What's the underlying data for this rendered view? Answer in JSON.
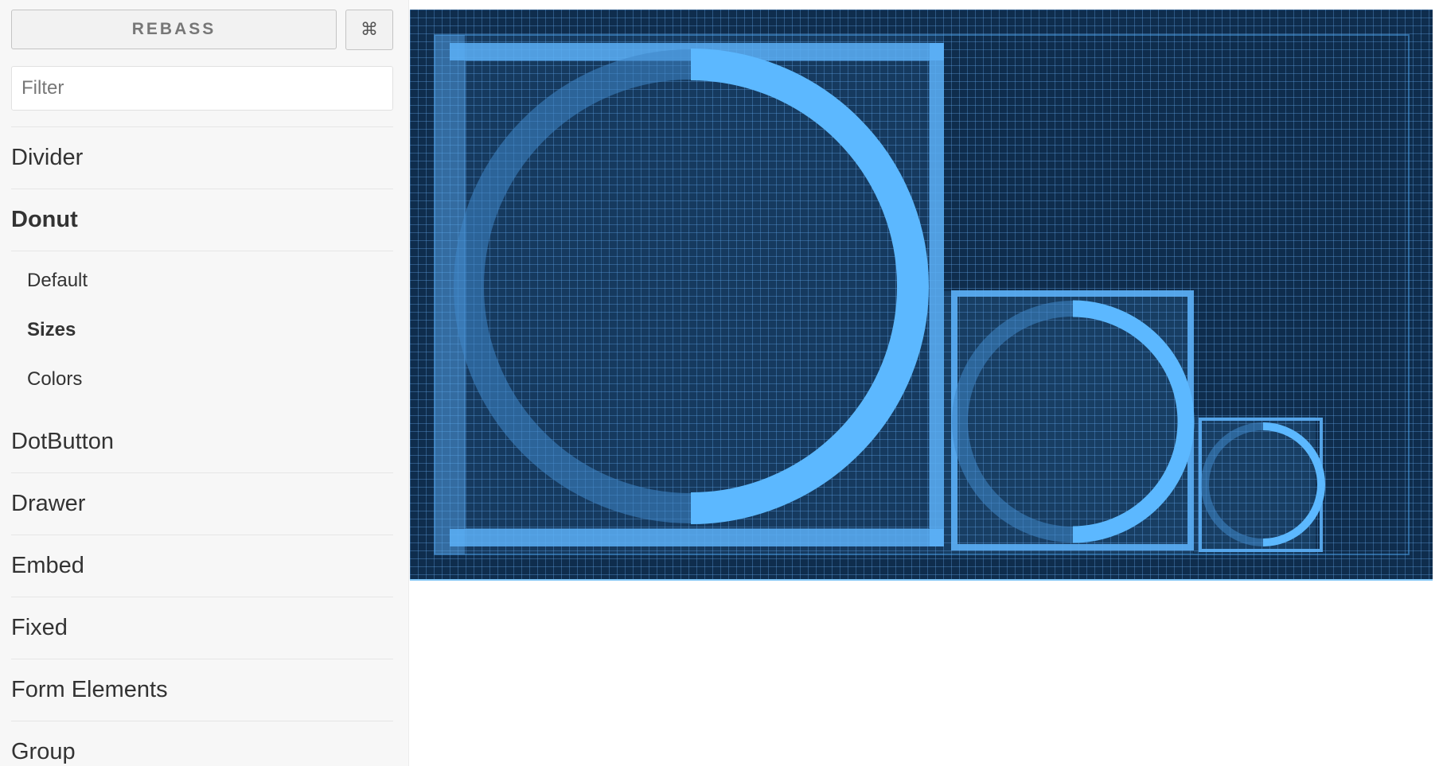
{
  "toolbar": {
    "brand_label": "REBASS",
    "command_label": "⌘"
  },
  "search": {
    "placeholder": "Filter",
    "value": ""
  },
  "sidebar": {
    "items": [
      {
        "label": "Divider",
        "active": false
      },
      {
        "label": "Donut",
        "active": true,
        "stories": [
          {
            "label": "Default",
            "active": false
          },
          {
            "label": "Sizes",
            "active": true
          },
          {
            "label": "Colors",
            "active": false
          }
        ]
      },
      {
        "label": "DotButton",
        "active": false
      },
      {
        "label": "Drawer",
        "active": false
      },
      {
        "label": "Embed",
        "active": false
      },
      {
        "label": "Fixed",
        "active": false
      },
      {
        "label": "Form Elements",
        "active": false
      },
      {
        "label": "Group",
        "active": false
      }
    ]
  },
  "preview": {
    "component": "Donut",
    "story": "Sizes",
    "donut_values": [
      0.5,
      0.5,
      0.5
    ],
    "size_order": [
      "large",
      "medium",
      "small"
    ],
    "colors": {
      "background": "#0f2d4d",
      "grid": "#5fa8e8",
      "donut_fill": "#5cb8ff",
      "donut_track": "#3f86c8",
      "outline": "#4ea6f0"
    }
  }
}
